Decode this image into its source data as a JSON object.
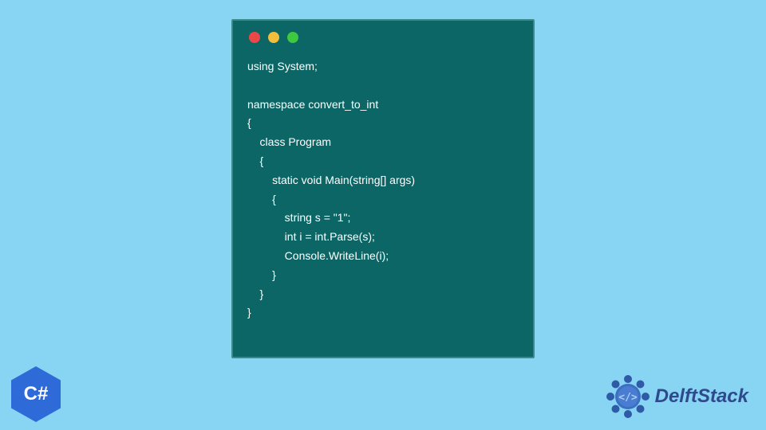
{
  "code_window": {
    "traffic_lights": {
      "red": "#ed4848",
      "yellow": "#f2be3c",
      "green": "#3fc93f"
    },
    "code": "using System;\n\nnamespace convert_to_int\n{\n    class Program\n    {\n        static void Main(string[] args)\n        {\n            string s = \"1\";\n            int i = int.Parse(s);\n            Console.WriteLine(i);\n        }\n    }\n}"
  },
  "csharp_logo": {
    "text": "C#"
  },
  "delftstack_logo": {
    "text": "DelftStack"
  },
  "colors": {
    "background": "#87d5f2",
    "window_bg": "#0c6666",
    "window_border": "#3b8a8a",
    "code_text": "#ffffff",
    "csharp_bg": "#2f6bd8",
    "delft_text": "#2e4a8c"
  }
}
